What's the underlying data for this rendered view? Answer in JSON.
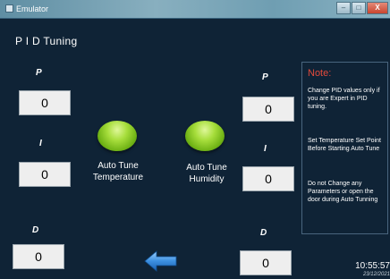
{
  "window": {
    "title": "Emulator",
    "buttons": {
      "minimize": "–",
      "maximize": "□",
      "close": "X"
    }
  },
  "screen": {
    "title": "P I D Tuning"
  },
  "temperature": {
    "p_label": "P",
    "p_value": "0",
    "i_label": "I",
    "i_value": "0",
    "d_label": "D",
    "d_value": "0"
  },
  "humidity": {
    "p_label": "P",
    "p_value": "0",
    "i_label": "I",
    "i_value": "0",
    "d_label": "D",
    "d_value": "0"
  },
  "auto_tune": {
    "temperature_line1": "Auto Tune",
    "temperature_line2": "Temperature",
    "humidity_line1": "Auto Tune",
    "humidity_line2": "Humidity",
    "button_color": "#8fd12c"
  },
  "note": {
    "title": "Note:",
    "title_color": "#e24a3b",
    "line1": "Change PID values only if you are Expert in PID tuning.",
    "line2": "Set Temperature Set Point Before Starting Auto Tune",
    "line3": "Do not Change any Parameters or open the door during Auto Tunning"
  },
  "navigation": {
    "back_icon": "back-arrow-icon",
    "arrow_color": "#3b8fe0"
  },
  "clock": {
    "time": "10:55:57",
    "date": "23/12/2021"
  }
}
